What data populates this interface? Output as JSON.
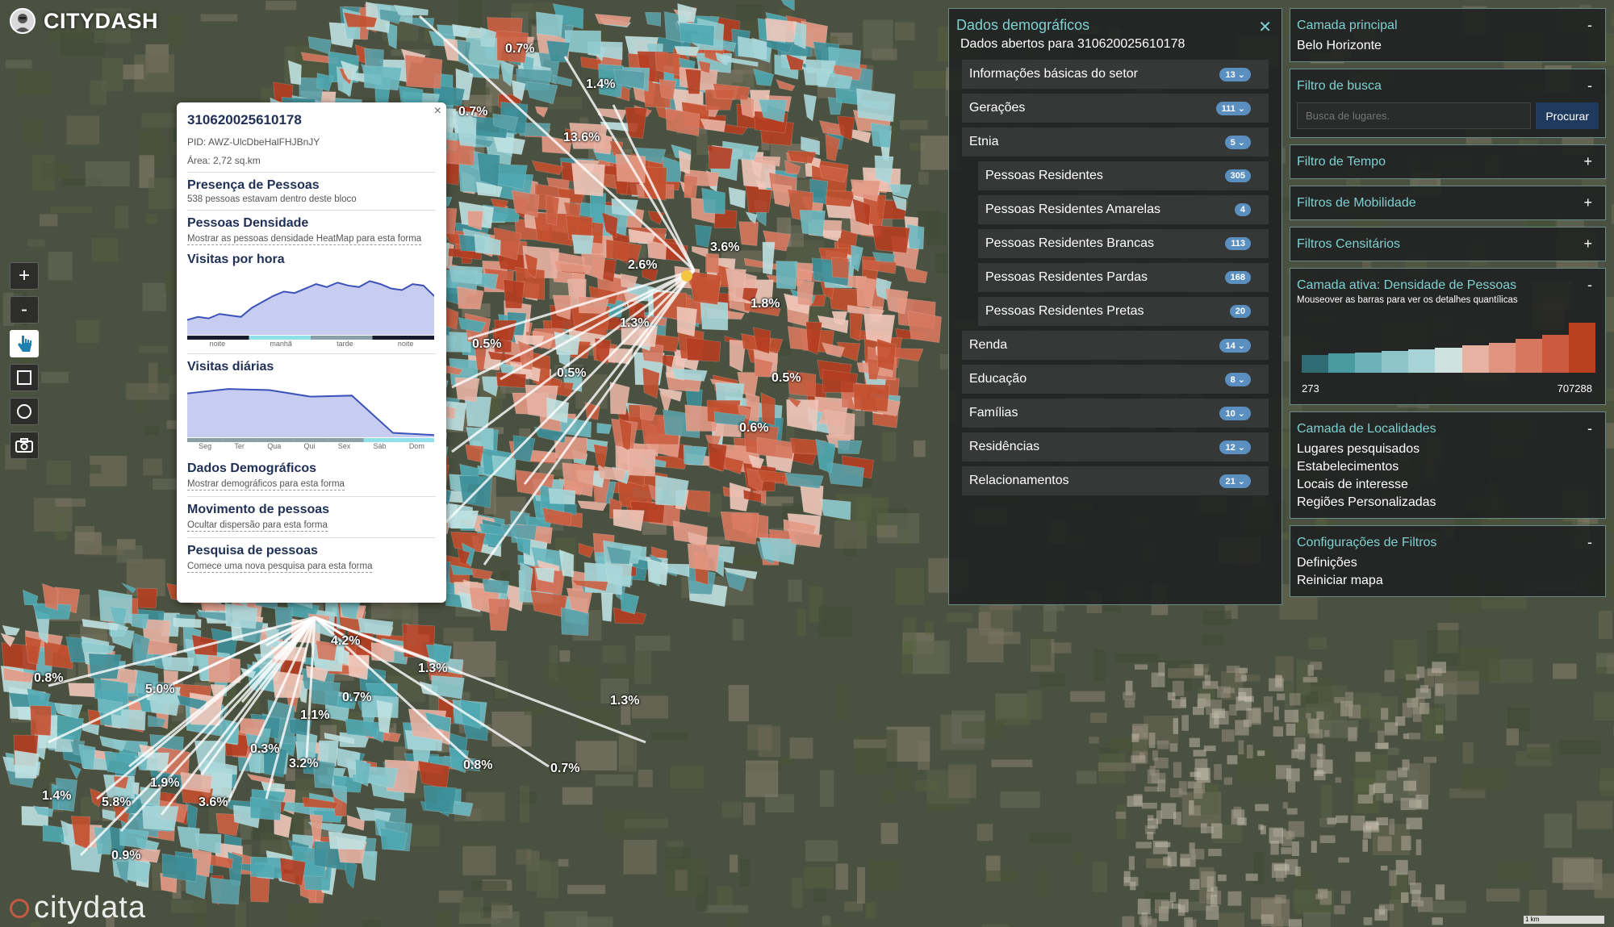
{
  "app": {
    "title": "CITYDASH",
    "watermark": "citydata"
  },
  "tools": [
    {
      "name": "zoom-in-button",
      "glyph": "+"
    },
    {
      "name": "zoom-out-button",
      "glyph": "-"
    }
  ],
  "popup": {
    "id": "310620025610178",
    "pid": "PID: AWZ-UlcDbeHalFHJBnJY",
    "area": "Área: 2,72 sq.km",
    "presence_title": "Presença de Pessoas",
    "presence_desc": "538 pessoas estavam dentro deste bloco",
    "density_title": "Pessoas Densidade",
    "density_desc": "Mostrar as pessoas densidade HeatMap para esta forma",
    "hourly_title": "Visitas por hora",
    "hourly_labels": [
      "noite",
      "manhã",
      "tarde",
      "noite"
    ],
    "hourly_values": [
      10,
      12,
      11,
      14,
      13,
      12,
      18,
      22,
      26,
      29,
      28,
      31,
      34,
      32,
      35,
      33,
      32,
      36,
      34,
      31,
      30,
      34,
      33,
      26
    ],
    "daily_title": "Visitas diárias",
    "daily_labels": [
      "Seg",
      "Ter",
      "Qua",
      "Qui",
      "Sex",
      "Sáb",
      "Dom"
    ],
    "daily_values": [
      40,
      44,
      43,
      37,
      38,
      4,
      2
    ],
    "demographics_title": "Dados Demográficos",
    "demographics_desc": "Mostrar demográficos para esta forma",
    "movement_title": "Movimento de pessoas",
    "movement_desc": "Ocultar dispersão para esta forma",
    "search_title": "Pesquisa de pessoas",
    "search_desc": "Comece uma nova pesquisa para esta forma"
  },
  "demographics": {
    "title": "Dados demográficos",
    "subtitle": "Dados abertos para 310620025610178",
    "rows": [
      {
        "label": "Informações básicas do setor",
        "badge": "13",
        "chevron": true,
        "sub": false
      },
      {
        "label": "Gerações",
        "badge": "111",
        "chevron": true,
        "sub": false
      },
      {
        "label": "Etnia",
        "badge": "5",
        "chevron": true,
        "sub": false
      },
      {
        "label": "Pessoas Residentes",
        "badge": "305",
        "chevron": false,
        "sub": true
      },
      {
        "label": "Pessoas Residentes Amarelas",
        "badge": "4",
        "chevron": false,
        "sub": true
      },
      {
        "label": "Pessoas Residentes Brancas",
        "badge": "113",
        "chevron": false,
        "sub": true
      },
      {
        "label": "Pessoas Residentes Pardas",
        "badge": "168",
        "chevron": false,
        "sub": true
      },
      {
        "label": "Pessoas Residentes Pretas",
        "badge": "20",
        "chevron": false,
        "sub": true
      },
      {
        "label": "Renda",
        "badge": "14",
        "chevron": true,
        "sub": false
      },
      {
        "label": "Educação",
        "badge": "8",
        "chevron": true,
        "sub": false
      },
      {
        "label": "Famílias",
        "badge": "10",
        "chevron": true,
        "sub": false
      },
      {
        "label": "Residências",
        "badge": "12",
        "chevron": true,
        "sub": false
      },
      {
        "label": "Relacionamentos",
        "badge": "21",
        "chevron": true,
        "sub": false
      }
    ]
  },
  "sidebar": {
    "main_layer": {
      "title": "Camada principal",
      "toggle": "-",
      "value": "Belo Horizonte"
    },
    "search_filter": {
      "title": "Filtro de busca",
      "toggle": "-",
      "placeholder": "Busca de lugares.",
      "button": "Procurar"
    },
    "time_filter": {
      "title": "Filtro de Tempo",
      "toggle": "+"
    },
    "mobility_filter": {
      "title": "Filtros de Mobilidade",
      "toggle": "+"
    },
    "census_filter": {
      "title": "Filtros Censitários",
      "toggle": "+"
    },
    "active_layer": {
      "title": "Camada ativa: Densidade de Pessoas",
      "toggle": "-",
      "note": "Mouseover as barras para ver os detalhes quantílicas",
      "min": "273",
      "max": "707288",
      "bars": [
        {
          "color": "#2e6b72",
          "level": 0.35
        },
        {
          "color": "#4a9aa2",
          "level": 0.38
        },
        {
          "color": "#6eb1b8",
          "level": 0.41
        },
        {
          "color": "#8cc4c9",
          "level": 0.44
        },
        {
          "color": "#a8d3d6",
          "level": 0.47
        },
        {
          "color": "#cfe2df",
          "level": 0.5
        },
        {
          "color": "#e8b2a3",
          "level": 0.55
        },
        {
          "color": "#e0937e",
          "level": 0.6
        },
        {
          "color": "#d7775f",
          "level": 0.68
        },
        {
          "color": "#c95a3e",
          "level": 0.76
        },
        {
          "color": "#b8401f",
          "level": 1.0
        }
      ]
    },
    "places_layer": {
      "title": "Camada de Localidades",
      "toggle": "-",
      "items": [
        "Lugares pesquisados",
        "Estabelecimentos",
        "Locais de interesse",
        "Regiões Personalizadas"
      ]
    },
    "filter_config": {
      "title": "Configurações de Filtros",
      "toggle": "-",
      "items": [
        "Definições",
        "Reiniciar mapa"
      ]
    }
  },
  "map_labels": [
    "0.7%",
    "1.4%",
    "0.7%",
    "13.6%",
    "3.6%",
    "2.6%",
    "1.8%",
    "1.3%",
    "0.5%",
    "0.5%",
    "0.5%",
    "0.6%",
    "4.2%",
    "1.3%",
    "1.3%",
    "0.8%",
    "5.0%",
    "0.7%",
    "1.1%",
    "0.3%",
    "3.2%",
    "0.8%",
    "0.7%",
    "1.4%",
    "1.9%",
    "5.8%",
    "3.6%",
    "0.9%"
  ],
  "scale_label": "1 km",
  "colors": {
    "accent": "#7fd0d0",
    "badge": "#5b8fc0",
    "button": "#1f3a5c"
  }
}
